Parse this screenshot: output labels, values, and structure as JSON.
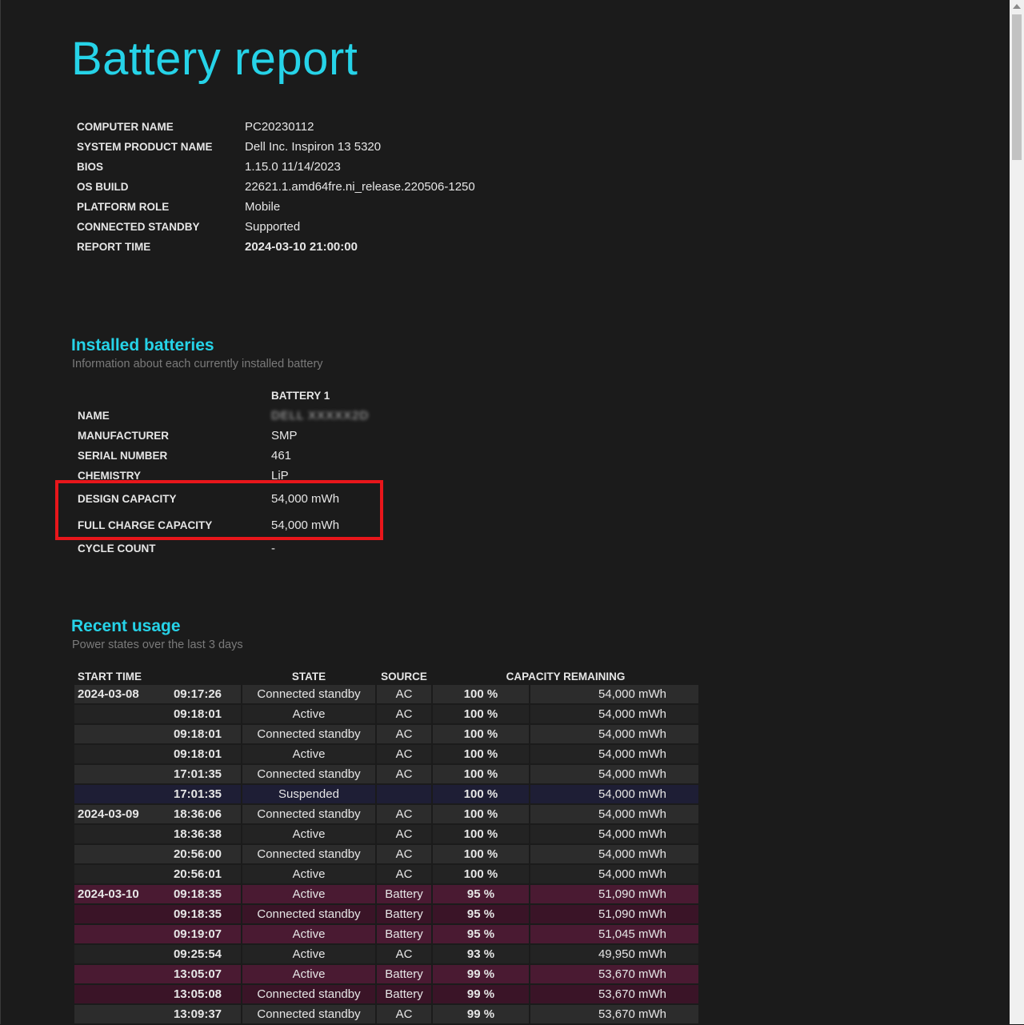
{
  "title": "Battery report",
  "system": [
    {
      "key": "COMPUTER NAME",
      "value": "PC20230112"
    },
    {
      "key": "SYSTEM PRODUCT NAME",
      "value": "Dell Inc. Inspiron 13 5320"
    },
    {
      "key": "BIOS",
      "value": "1.15.0 11/14/2023"
    },
    {
      "key": "OS BUILD",
      "value": "22621.1.amd64fre.ni_release.220506-1250"
    },
    {
      "key": "PLATFORM ROLE",
      "value": "Mobile"
    },
    {
      "key": "CONNECTED STANDBY",
      "value": "Supported"
    },
    {
      "key": "REPORT TIME",
      "value": "2024-03-10  21:00:00"
    }
  ],
  "installed": {
    "heading": "Installed batteries",
    "subheading": "Information about each currently installed battery",
    "column": "BATTERY 1",
    "rows": [
      {
        "key": "NAME",
        "value": "DELL XXXXX2D"
      },
      {
        "key": "MANUFACTURER",
        "value": "SMP"
      },
      {
        "key": "SERIAL NUMBER",
        "value": "461"
      },
      {
        "key": "CHEMISTRY",
        "value": "LiP"
      },
      {
        "key": "DESIGN CAPACITY",
        "value": "54,000 mWh"
      },
      {
        "key": "FULL CHARGE CAPACITY",
        "value": "54,000 mWh"
      },
      {
        "key": "CYCLE COUNT",
        "value": "-"
      }
    ]
  },
  "usage": {
    "heading": "Recent usage",
    "subheading": "Power states over the last 3 days",
    "headers": {
      "start": "START TIME",
      "state": "STATE",
      "source": "SOURCE",
      "capacity": "CAPACITY REMAINING"
    },
    "rows": [
      {
        "date": "2024-03-08",
        "time": "09:17:26",
        "state": "Connected standby",
        "source": "AC",
        "pct": "100 %",
        "mwh": "54,000 mWh"
      },
      {
        "date": "",
        "time": "09:18:01",
        "state": "Active",
        "source": "AC",
        "pct": "100 %",
        "mwh": "54,000 mWh"
      },
      {
        "date": "",
        "time": "09:18:01",
        "state": "Connected standby",
        "source": "AC",
        "pct": "100 %",
        "mwh": "54,000 mWh"
      },
      {
        "date": "",
        "time": "09:18:01",
        "state": "Active",
        "source": "AC",
        "pct": "100 %",
        "mwh": "54,000 mWh"
      },
      {
        "date": "",
        "time": "17:01:35",
        "state": "Connected standby",
        "source": "AC",
        "pct": "100 %",
        "mwh": "54,000 mWh"
      },
      {
        "date": "",
        "time": "17:01:35",
        "state": "Suspended",
        "source": "",
        "pct": "100 %",
        "mwh": "54,000 mWh"
      },
      {
        "date": "2024-03-09",
        "time": "18:36:06",
        "state": "Connected standby",
        "source": "AC",
        "pct": "100 %",
        "mwh": "54,000 mWh"
      },
      {
        "date": "",
        "time": "18:36:38",
        "state": "Active",
        "source": "AC",
        "pct": "100 %",
        "mwh": "54,000 mWh"
      },
      {
        "date": "",
        "time": "20:56:00",
        "state": "Connected standby",
        "source": "AC",
        "pct": "100 %",
        "mwh": "54,000 mWh"
      },
      {
        "date": "",
        "time": "20:56:01",
        "state": "Active",
        "source": "AC",
        "pct": "100 %",
        "mwh": "54,000 mWh"
      },
      {
        "date": "2024-03-10",
        "time": "09:18:35",
        "state": "Active",
        "source": "Battery",
        "pct": "95 %",
        "mwh": "51,090 mWh"
      },
      {
        "date": "",
        "time": "09:18:35",
        "state": "Connected standby",
        "source": "Battery",
        "pct": "95 %",
        "mwh": "51,090 mWh"
      },
      {
        "date": "",
        "time": "09:19:07",
        "state": "Active",
        "source": "Battery",
        "pct": "95 %",
        "mwh": "51,045 mWh"
      },
      {
        "date": "",
        "time": "09:25:54",
        "state": "Active",
        "source": "AC",
        "pct": "93 %",
        "mwh": "49,950 mWh"
      },
      {
        "date": "",
        "time": "13:05:07",
        "state": "Active",
        "source": "Battery",
        "pct": "99 %",
        "mwh": "53,670 mWh"
      },
      {
        "date": "",
        "time": "13:05:08",
        "state": "Connected standby",
        "source": "Battery",
        "pct": "99 %",
        "mwh": "53,670 mWh"
      },
      {
        "date": "",
        "time": "13:09:37",
        "state": "Connected standby",
        "source": "AC",
        "pct": "99 %",
        "mwh": "53,670 mWh"
      }
    ]
  },
  "colors": {
    "accent": "#26d3e8",
    "highlight_box": "#e8161b",
    "battery_row": "#4a1a32",
    "suspended_row": "#1e1e35"
  }
}
